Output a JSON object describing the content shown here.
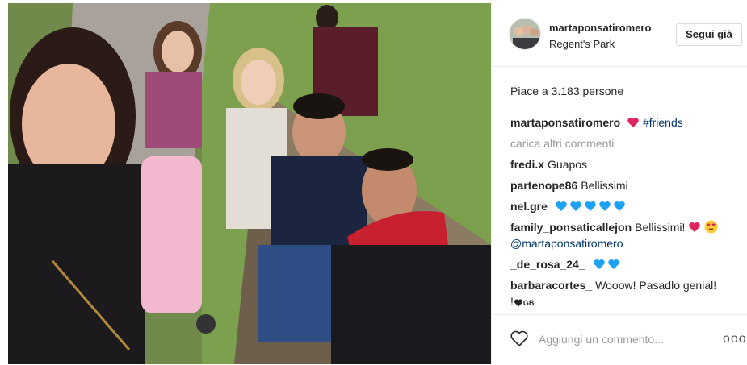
{
  "post": {
    "username": "martaponsatiromero",
    "location": "Regent's Park",
    "follow_label": "Segui già",
    "likes_text": "Piace a 3.183 persone",
    "caption": {
      "user": "martaponsatiromero",
      "hashtag": "#friends"
    },
    "load_more": "carica altri commenti",
    "comments": [
      {
        "user": "fredi.x",
        "text": "Guapos"
      },
      {
        "user": "partenope86",
        "text": "Bellissimi"
      },
      {
        "user": "nel.gre",
        "text": ""
      },
      {
        "user": "family_ponsaticallejon",
        "text": "Bellissimi!",
        "mention": "@martaponsatiromero"
      },
      {
        "user": "_de_rosa_24_",
        "text": ""
      },
      {
        "user": "barbaracortes_",
        "text": "Wooow! Pasadlo genial!",
        "tail": "!",
        "small": "GB"
      }
    ],
    "add_comment_placeholder": "Aggiungi un commento...",
    "more_label": "ooo"
  },
  "icons": {
    "like": "heart-outline-icon",
    "more": "more-options-icon",
    "emoji_heart": "red-heart-emoji",
    "emoji_blue": "blue-heart-emoji",
    "emoji_eyes": "heart-eyes-emoji",
    "small_heart": "black-heart-icon"
  },
  "colors": {
    "text": "#262626",
    "muted": "#999999",
    "hashtag": "#003569",
    "border": "#dbdbdb",
    "red_heart": "#e0245e",
    "blue_heart": "#1da1f2"
  }
}
